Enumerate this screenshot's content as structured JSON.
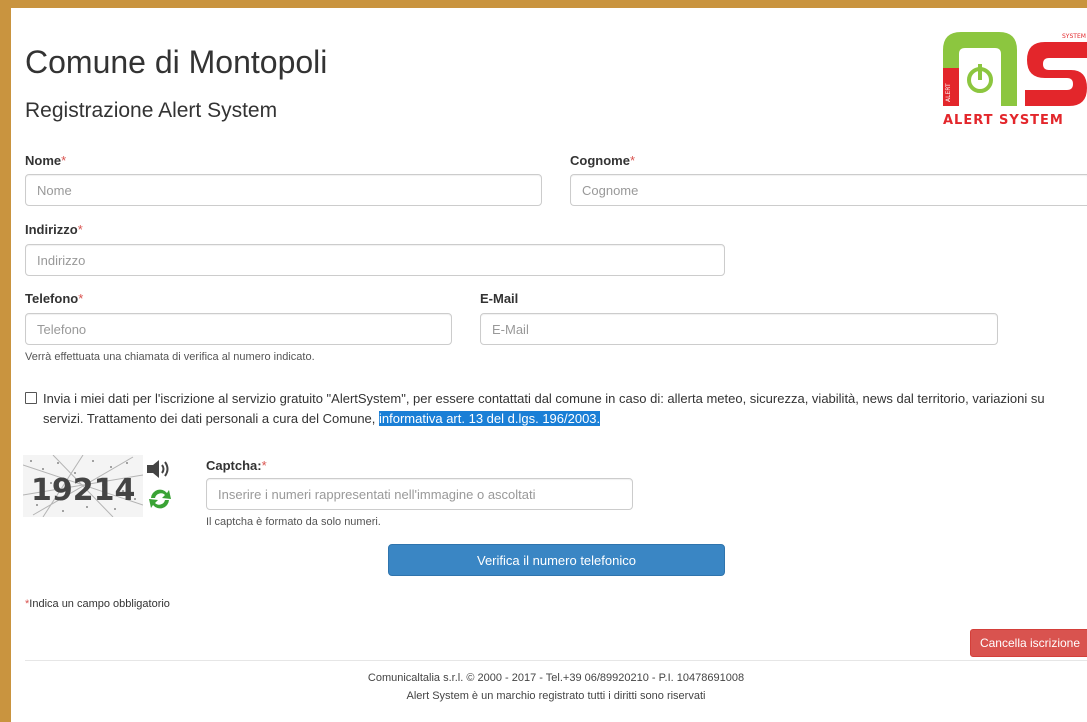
{
  "header": {
    "title": "Comune di Montopoli",
    "subtitle": "Registrazione Alert System"
  },
  "logo": {
    "tagline": "ALERT SYSTEM",
    "badge_small": "SYSTEM",
    "side_text": "ALERT",
    "colors": {
      "red": "#e3262b",
      "green": "#8cc63f"
    }
  },
  "form": {
    "nome": {
      "label": "Nome",
      "placeholder": "Nome"
    },
    "cognome": {
      "label": "Cognome",
      "placeholder": "Cognome"
    },
    "indirizzo": {
      "label": "Indirizzo",
      "placeholder": "Indirizzo"
    },
    "telefono": {
      "label": "Telefono",
      "placeholder": "Telefono",
      "help": "Verrà effettuata una chiamata di verifica al numero indicato."
    },
    "email": {
      "label": "E-Mail",
      "placeholder": "E-Mail"
    },
    "required_mark": "*",
    "consent": {
      "text": "Invia i miei dati per l'iscrizione al servizio gratuito \"AlertSystem\", per essere contattati dal comune in caso di: allerta meteo, sicurezza, viabilità, news dal territorio, variazioni su servizi. Trattamento dei dati personali a cura del Comune, ",
      "link": "informativa art. 13 del d.lgs. 196/2003."
    },
    "captcha": {
      "label": "Captcha:",
      "placeholder": "Inserire i numeri rappresentati nell'immagine o ascoltati",
      "help": "Il captcha è formato da solo numeri.",
      "code": "19214"
    },
    "verify_button": "Verifica il numero telefonico",
    "required_legend": "Indica un campo obbligatorio",
    "cancel_button": "Cancella iscrizione"
  },
  "footer": {
    "line1": "Comunicaltalia s.r.l. © 2000 - 2017 - Tel.+39 06/89920210 - P.I. 10478691008",
    "line2": "Alert System è un marchio registrato tutti i diritti sono riservati"
  },
  "colors": {
    "frame": "#c9943f",
    "primary": "#3a86c4",
    "danger": "#d9534f",
    "highlight": "#1a7fd6"
  }
}
